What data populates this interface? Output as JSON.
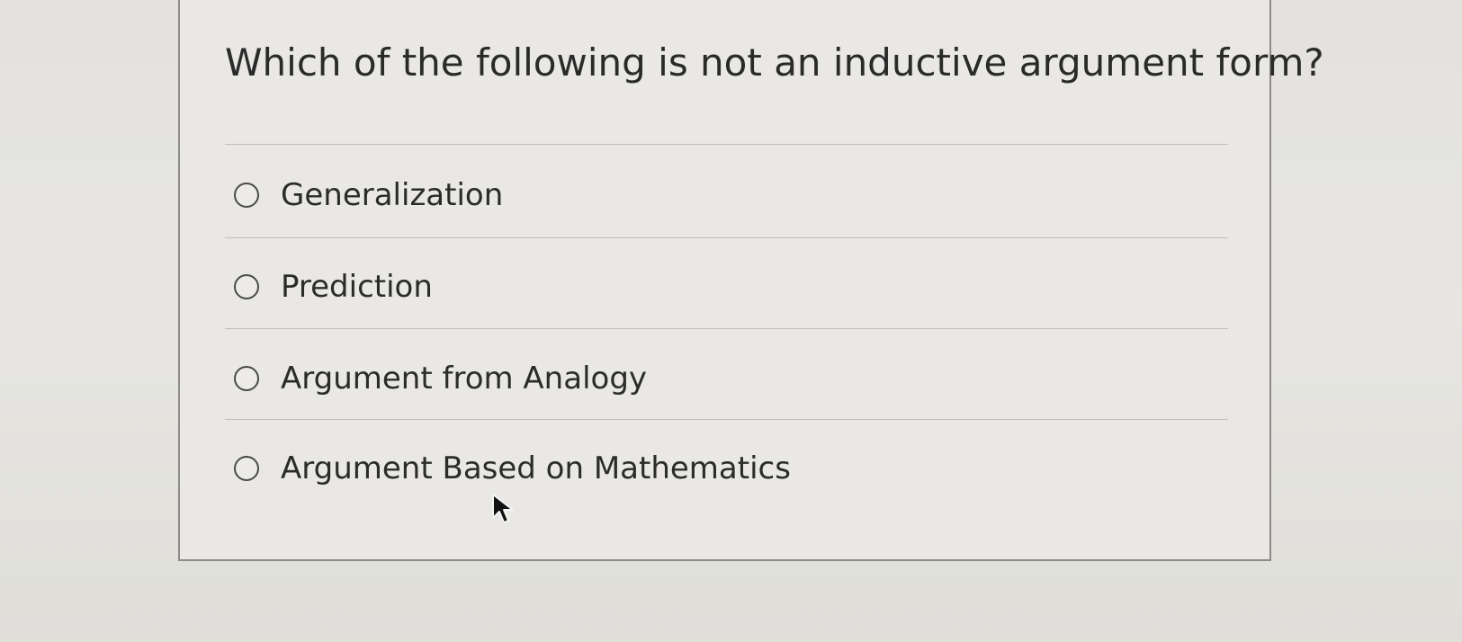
{
  "question": {
    "title": "Which of the following is not an inductive argument form?"
  },
  "options": [
    {
      "label": "Generalization",
      "selected": false
    },
    {
      "label": "Prediction",
      "selected": false
    },
    {
      "label": "Argument from Analogy",
      "selected": false
    },
    {
      "label": "Argument Based on Mathematics",
      "selected": false
    }
  ],
  "icons": {
    "radio": "radio-button-unchecked",
    "cursor": "mouse-pointer-arrow"
  },
  "colors": {
    "background": "#e4e3df",
    "card_border": "#8d8c89",
    "text": "#2b2b2b",
    "divider": "#bebdb9"
  }
}
